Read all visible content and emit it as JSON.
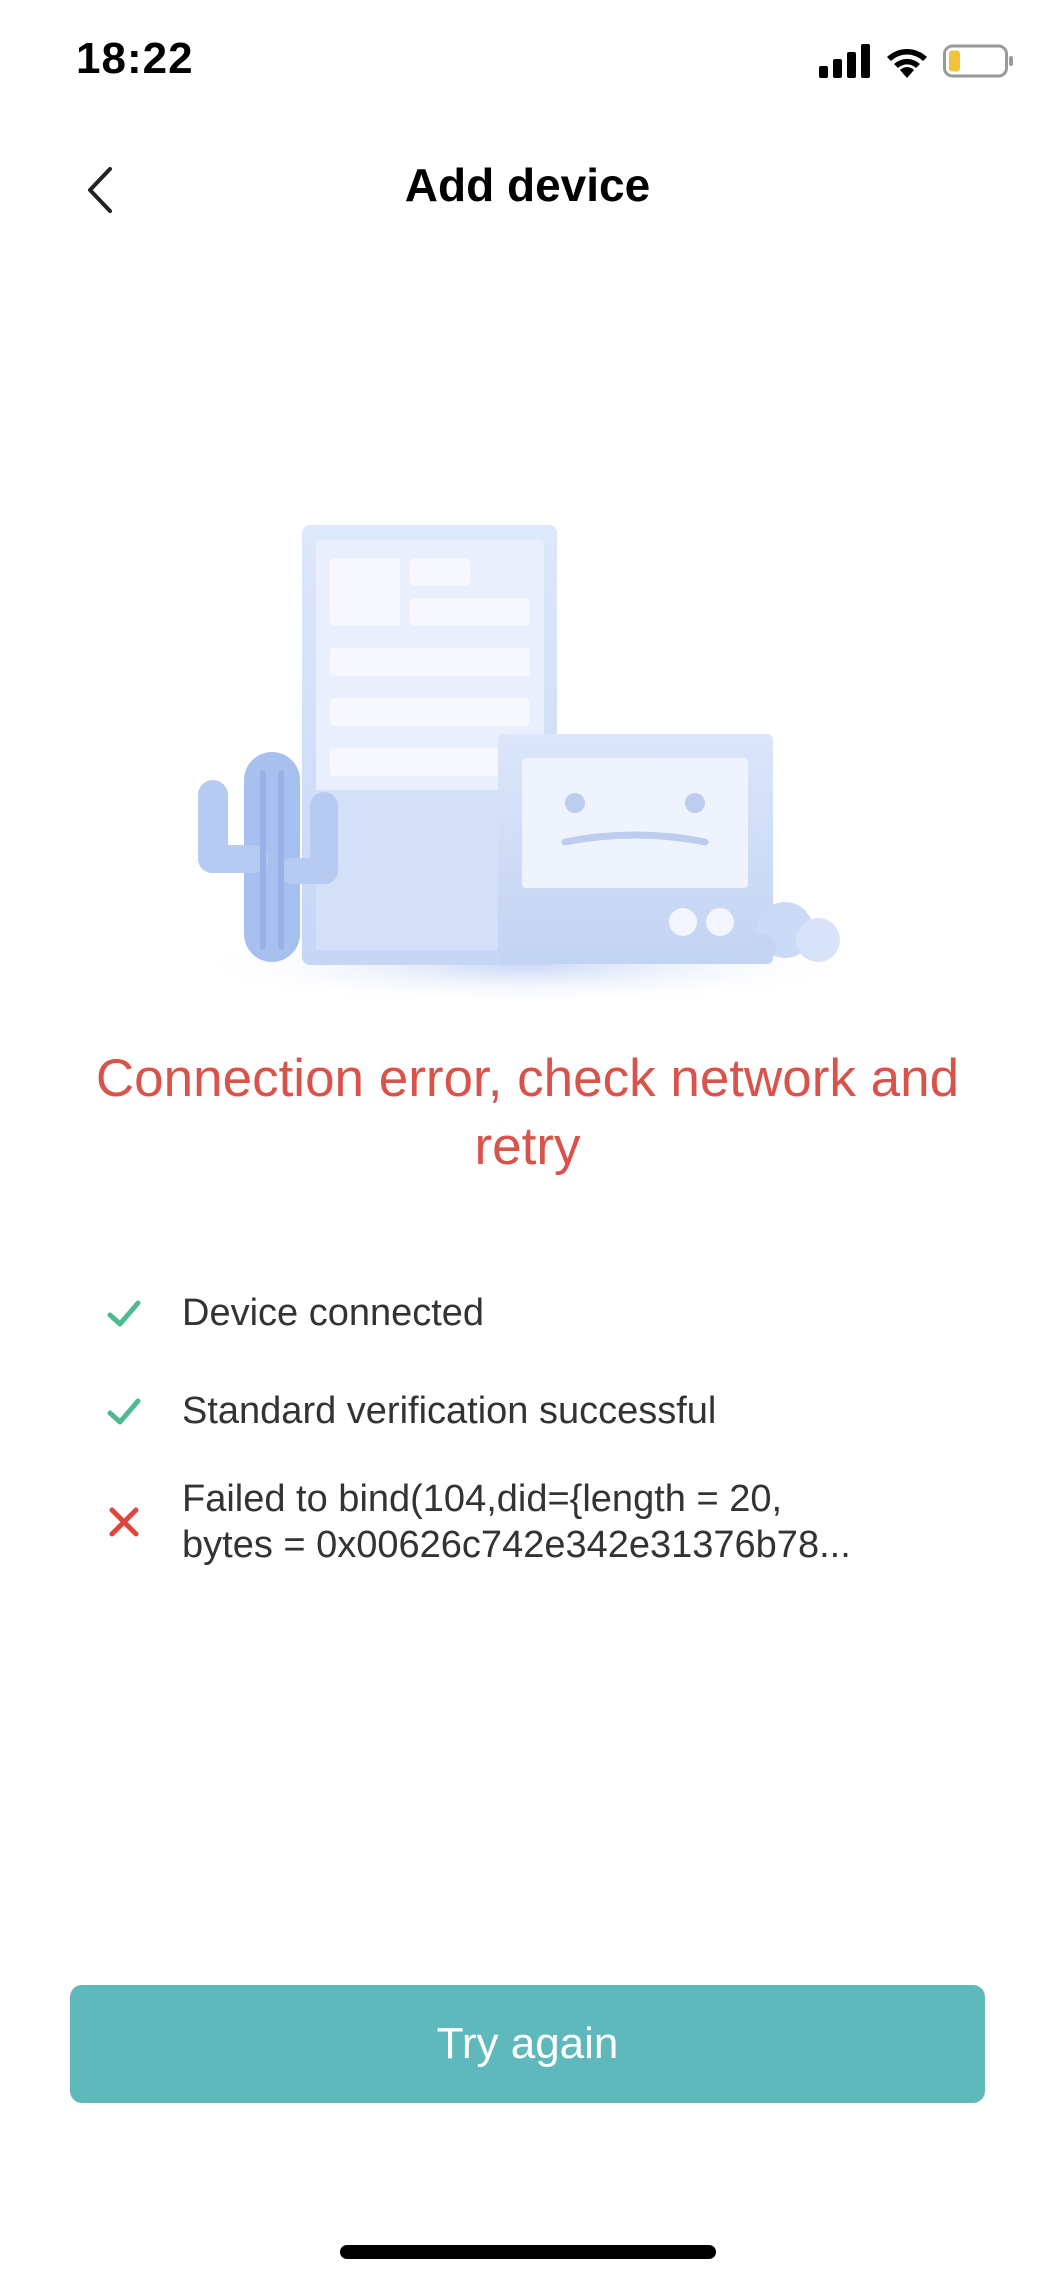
{
  "status_bar": {
    "time": "18:22"
  },
  "nav": {
    "title": "Add device"
  },
  "error": {
    "message": "Connection error, check network and retry",
    "color": "#d9534a"
  },
  "steps": [
    {
      "status": "success",
      "text": "Device connected"
    },
    {
      "status": "success",
      "text": "Standard verification successful"
    },
    {
      "status": "failed",
      "text": "Failed to bind(104,did={length = 20,",
      "text_line2": "bytes = 0x00626c742e342e31376b78..."
    }
  ],
  "actions": {
    "retry_label": "Try again"
  },
  "colors": {
    "success": "#4dbb8f",
    "failure": "#e0453c",
    "button": "#5fb8bc"
  }
}
